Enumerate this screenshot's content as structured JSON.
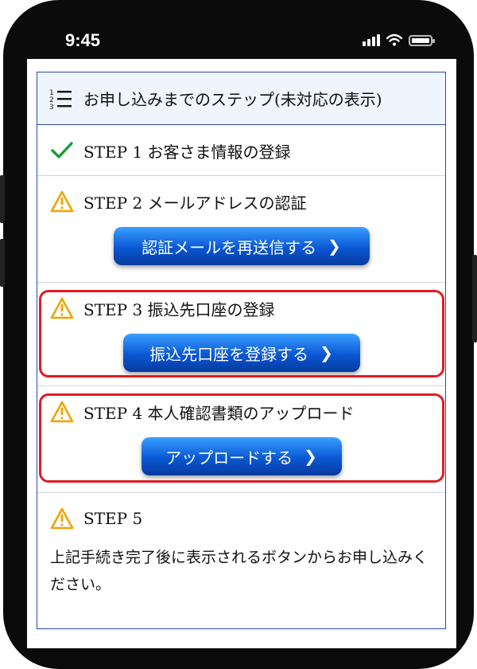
{
  "status_bar": {
    "time": "9:45"
  },
  "panel": {
    "title": "お申し込みまでのステップ(未対応の表示)",
    "steps": [
      {
        "label": "STEP 1  お客さま情報の登録",
        "status": "done"
      },
      {
        "label": "STEP 2  メールアドレスの認証",
        "status": "warning",
        "button": "認証メールを再送信する"
      },
      {
        "label": "STEP 3  振込先口座の登録",
        "status": "warning",
        "button": "振込先口座を登録する",
        "highlighted": true
      },
      {
        "label": "STEP 4  本人確認書類のアップロード",
        "status": "warning",
        "button": "アップロードする",
        "highlighted": true
      },
      {
        "label": "STEP 5",
        "status": "warning",
        "note": "上記手続き完了後に表示されるボタンからお申し込みください。"
      }
    ]
  },
  "colors": {
    "frame_border": "#2a4aa8",
    "header_bg": "#eef5fc",
    "warning": "#f0a500",
    "check": "#1a9a3a",
    "highlight": "#e01b22",
    "button": "#0a57d4"
  },
  "icons": [
    "list-numbered-icon",
    "check-icon",
    "warning-icon",
    "chevron-right-icon",
    "signal-icon",
    "wifi-icon",
    "battery-icon"
  ]
}
